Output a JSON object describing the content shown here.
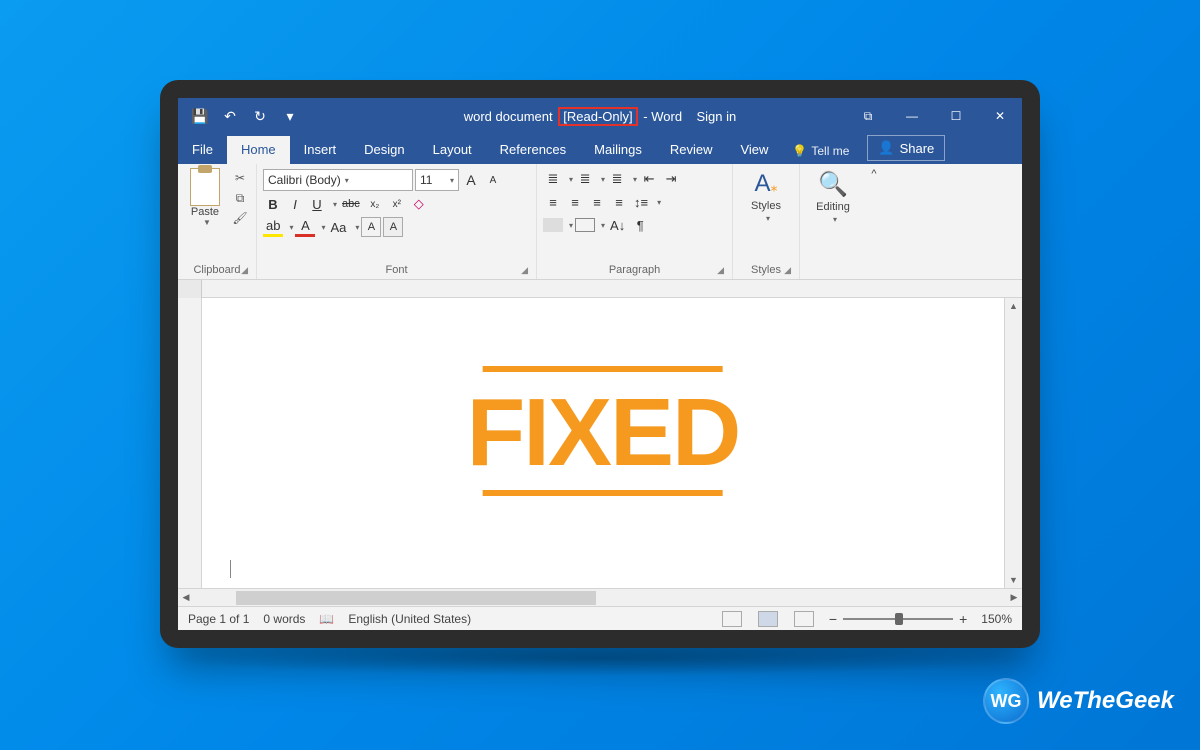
{
  "titlebar": {
    "doc_name": "word document",
    "readonly": "[Read-Only]",
    "app_sep": "-",
    "app_name": "Word",
    "signin": "Sign in"
  },
  "qat": {
    "save": "💾",
    "undo": "↶",
    "redo": "↻",
    "customise": "▾"
  },
  "window": {
    "restore": "⧉",
    "min": "—",
    "max": "☐",
    "close": "✕"
  },
  "tabs": {
    "file": "File",
    "home": "Home",
    "insert": "Insert",
    "design": "Design",
    "layout": "Layout",
    "references": "References",
    "mailings": "Mailings",
    "review": "Review",
    "view": "View",
    "tellme": "Tell me"
  },
  "share": "Share",
  "ribbon": {
    "clipboard": {
      "label": "Clipboard",
      "paste": "Paste"
    },
    "font": {
      "label": "Font",
      "name": "Calibri (Body)",
      "size": "11",
      "bold": "B",
      "italic": "I",
      "underline": "U",
      "strike": "abc",
      "sub": "x₂",
      "sup": "x²",
      "highlight": "ab",
      "fontcolor": "A",
      "case": "Aa",
      "grow": "A",
      "shrink": "A",
      "clear": "A",
      "effects": "A"
    },
    "paragraph": {
      "label": "Paragraph"
    },
    "styles": {
      "label": "Styles",
      "btn": "Styles"
    },
    "editing": {
      "label": "",
      "btn": "Editing"
    }
  },
  "overlay": {
    "stamp": "FIXED"
  },
  "status": {
    "page": "Page 1 of 1",
    "words": "0 words",
    "lang": "English (United States)",
    "zoom": "150%"
  },
  "watermark": {
    "text": "WeTheGeek",
    "logo": "WG"
  }
}
